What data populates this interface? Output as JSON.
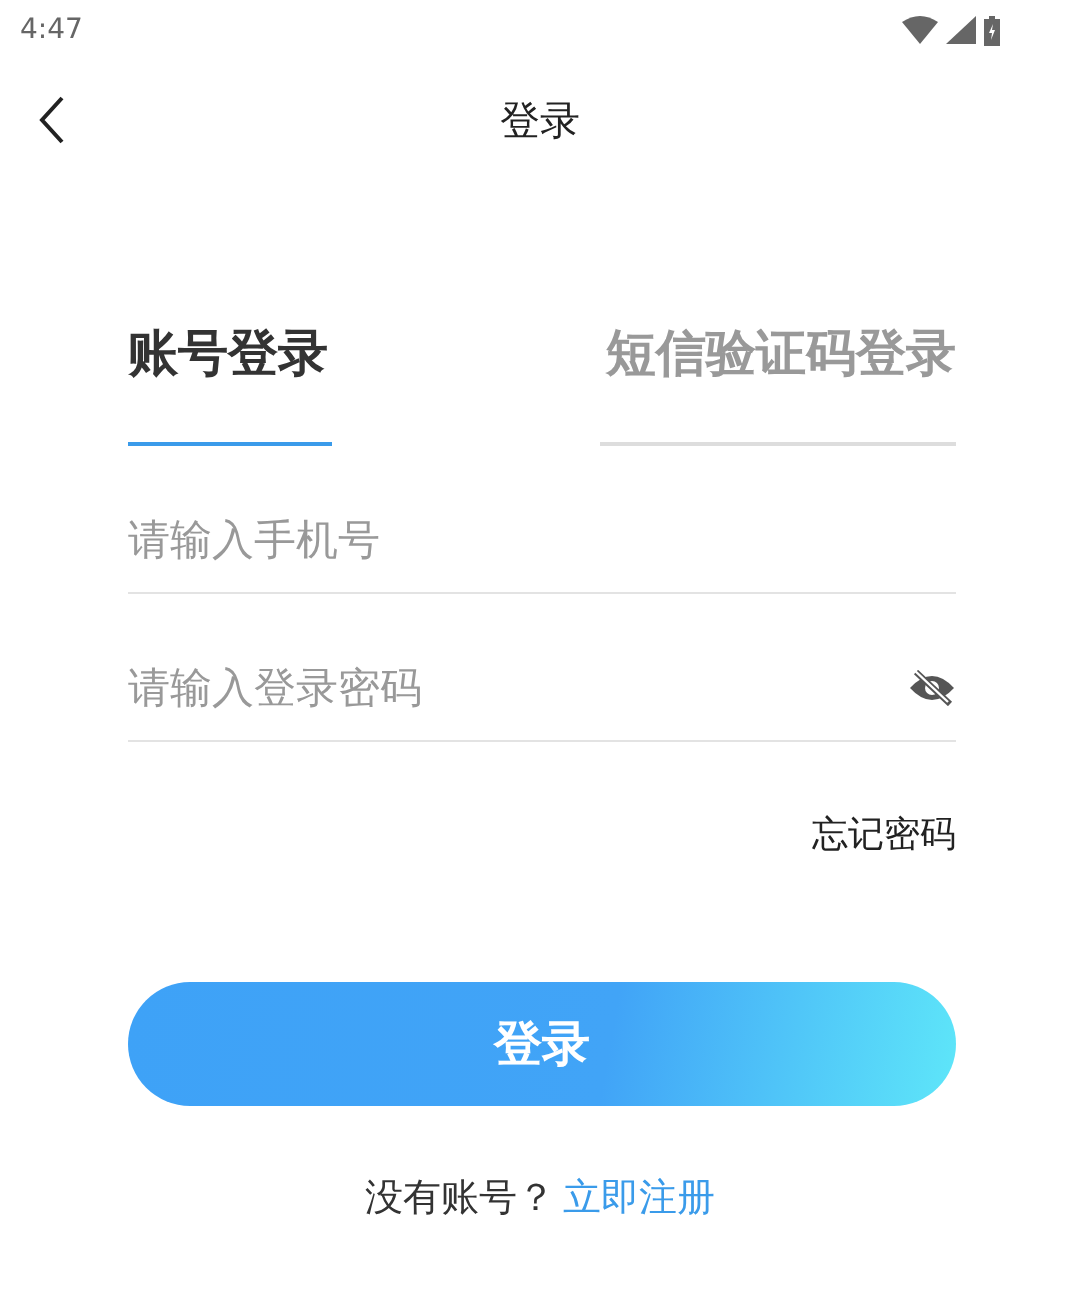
{
  "status_bar": {
    "time": "4:47"
  },
  "nav": {
    "title": "登录"
  },
  "tabs": [
    {
      "label": "账号登录",
      "selected": true
    },
    {
      "label": "短信验证码登录",
      "selected": false
    }
  ],
  "phone_field": {
    "placeholder": "请输入手机号"
  },
  "password_field": {
    "placeholder": "请输入登录密码",
    "password_visible": false
  },
  "forgot_link": "忘记密码",
  "login_button": "登录",
  "register": {
    "prompt": "没有账号？",
    "link": "立即注册"
  }
}
